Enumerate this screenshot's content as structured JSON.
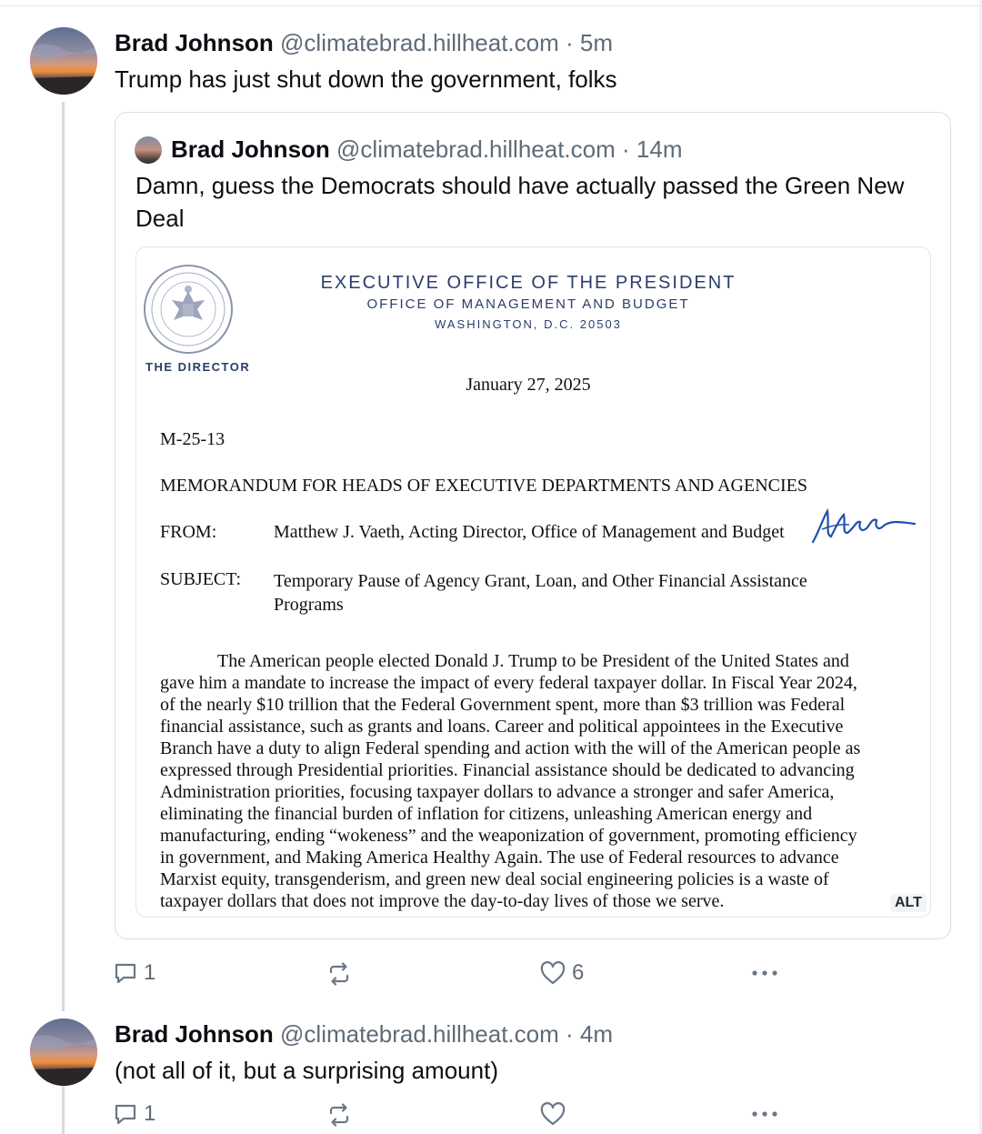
{
  "posts": [
    {
      "author": "Brad Johnson",
      "handle": "@climatebrad.hillheat.com",
      "time": "· 5m",
      "text": "Trump has just shut down the government, folks",
      "quote": {
        "author": "Brad Johnson",
        "handle": "@climatebrad.hillheat.com",
        "time": "· 14m",
        "text": "Damn, guess the Democrats should have actually passed the Green New Deal",
        "image": {
          "alt_badge": "ALT",
          "letterhead": {
            "title": "EXECUTIVE OFFICE OF THE PRESIDENT",
            "office": "OFFICE OF MANAGEMENT AND BUDGET",
            "address": "WASHINGTON, D.C. 20503",
            "director": "THE DIRECTOR"
          },
          "date": "January 27, 2025",
          "memo_number": "M-25-13",
          "heading": "MEMORANDUM FOR HEADS OF EXECUTIVE DEPARTMENTS AND AGENCIES",
          "from_label": "FROM:",
          "from_value": "Matthew J. Vaeth, Acting Director, Office of Management and Budget",
          "subject_label": "SUBJECT:",
          "subject_value": "Temporary Pause of Agency Grant, Loan, and Other Financial Assistance Programs",
          "body_lines": [
            "The American people elected Donald J. Trump to be President of the United States and",
            "gave him a mandate to increase the impact of every federal taxpayer dollar. In Fiscal Year 2024,",
            "of the nearly $10 trillion that the Federal Government spent, more than $3 trillion was Federal",
            "financial assistance, such as grants and loans. Career and political appointees in the Executive",
            "Branch have a duty to align Federal spending and action with the will of the American people as",
            "expressed through Presidential priorities. Financial assistance should be dedicated to advancing",
            "Administration priorities, focusing taxpayer dollars to advance a stronger and safer America,",
            "eliminating the financial burden of inflation for citizens, unleashing American energy and",
            "manufacturing, ending “wokeness” and the weaponization of government, promoting efficiency",
            "in government, and Making America Healthy Again. The use of Federal resources to advance",
            "Marxist equity, transgenderism, and green new deal social engineering policies is a waste of",
            "taxpayer dollars that does not improve the day-to-day lives of those we serve."
          ]
        }
      },
      "actions": {
        "replies": "1",
        "reposts": "",
        "likes": "6"
      }
    },
    {
      "author": "Brad Johnson",
      "handle": "@climatebrad.hillheat.com",
      "time": "· 4m",
      "text": "(not all of it, but a surprising amount)",
      "actions": {
        "replies": "1",
        "reposts": "",
        "likes": ""
      }
    }
  ],
  "icons": {
    "reply": "speech-bubble-icon",
    "repost": "repost-arrows-icon",
    "like": "heart-icon",
    "more": "ellipsis-icon"
  }
}
